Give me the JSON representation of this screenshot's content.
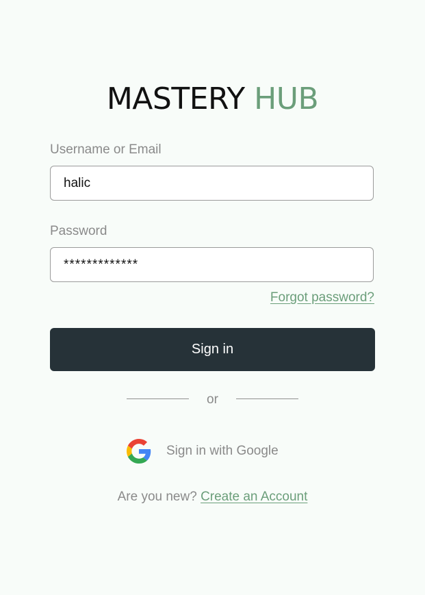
{
  "logo": {
    "word1": "MASTERY",
    "word2": "HUB"
  },
  "form": {
    "username_label": "Username or Email",
    "username_value": "halic",
    "password_label": "Password",
    "password_value": "*************",
    "forgot_link": "Forgot password?",
    "signin_label": "Sign in"
  },
  "divider": {
    "text": "or"
  },
  "google": {
    "label": "Sign in with Google",
    "icon": "google-icon"
  },
  "signup": {
    "prompt": "Are you new?",
    "link": "Create an Account"
  },
  "colors": {
    "background": "#f8fcf9",
    "accent_green": "#6b9e7a",
    "button_dark": "#263238",
    "muted_text": "#8a8a8a"
  }
}
